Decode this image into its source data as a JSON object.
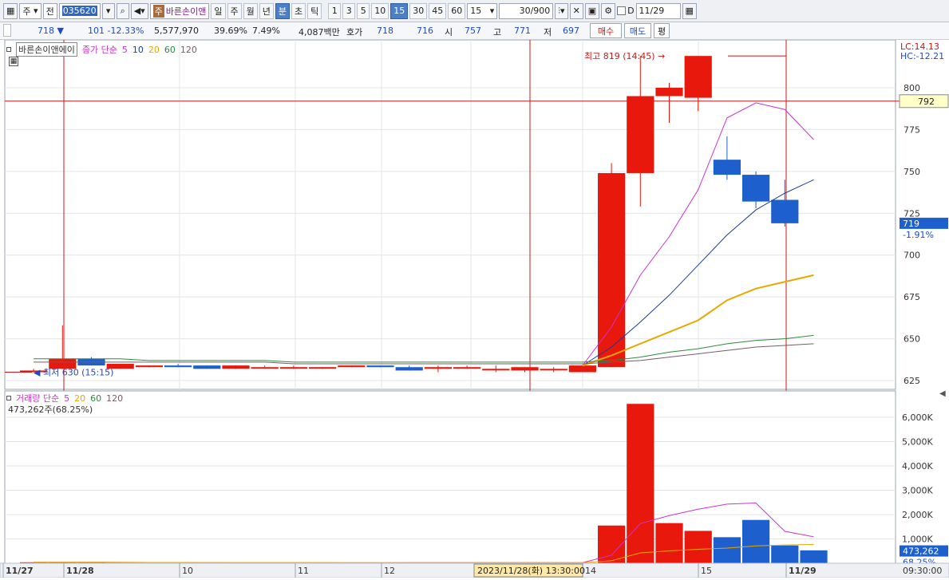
{
  "toolbar": {
    "market": "주",
    "prev_label": "전",
    "code": "035620",
    "name_prefix": "주",
    "name": "바른손이앤",
    "periods": [
      "일",
      "주",
      "월",
      "년",
      "분",
      "초",
      "틱"
    ],
    "active_period": "분",
    "minute_buttons": [
      "1",
      "3",
      "5",
      "10",
      "15",
      "30",
      "45",
      "60"
    ],
    "active_minute": "15",
    "minute_select": "15",
    "count_value": "30",
    "count_total": "/900",
    "checkbox_label": "D",
    "date_value": "11/29"
  },
  "info": {
    "price": "718",
    "arrow": "▼",
    "change": "101",
    "change_pct": "-12.33%",
    "volume": "5,577,970",
    "vol_ratio": "39.69%",
    "turnover": "7.49%",
    "amount": "4,087백만",
    "hoga_label": "호가",
    "ask": "718",
    "bid": "716",
    "open_label": "시",
    "open": "757",
    "high_label": "고",
    "high": "771",
    "low_label": "저",
    "low": "697",
    "buy_label": "매수",
    "sell_label": "매도",
    "eval_label": "평"
  },
  "price_panel": {
    "stock_label": "바른손이앤에이",
    "ma_label": "종가 단순",
    "ma_periods": [
      "5",
      "10",
      "20",
      "60",
      "120"
    ],
    "lc": "LC:14.13",
    "hc": "HC:-12.21",
    "crosshair_price": "792",
    "current_price": "719",
    "current_pct": "-1.91%",
    "high_annotation": "최고 819 (14:45)",
    "low_annotation": "최저 630 (15:15)",
    "y_ticks": [
      "800",
      "775",
      "750",
      "725",
      "700",
      "675",
      "650",
      "625"
    ]
  },
  "volume_panel": {
    "label": "거래량 단순",
    "ma_periods": [
      "5",
      "20",
      "60",
      "120"
    ],
    "summary": "473,262주(68.25%)",
    "current_vol": "473,262",
    "current_pct": "68.25%",
    "y_ticks": [
      "6,000K",
      "5,000K",
      "4,000K",
      "3,000K",
      "2,000K",
      "1,000K"
    ]
  },
  "x_axis": {
    "labels": [
      "11/27",
      "11/28",
      "10",
      "11",
      "12",
      "14",
      "15",
      "11/29"
    ],
    "crosshair_time": "2023/11/28(화) 13:30:00",
    "right_label": "09:30:00"
  },
  "colors": {
    "up": "#e8180c",
    "down": "#1d5fcc",
    "ma5": "#cc33cc",
    "ma10": "#1a3d99",
    "ma20": "#e8a800",
    "ma60": "#2e8b3a",
    "ma120": "#7a5a6a"
  },
  "chart_data": {
    "type": "candlestick",
    "interval": "15 minutes",
    "candles": [
      {
        "o": 630,
        "h": 632,
        "l": 630,
        "c": 631
      },
      {
        "o": 632,
        "h": 658,
        "l": 632,
        "c": 638
      },
      {
        "o": 638,
        "h": 639,
        "l": 634,
        "c": 634
      },
      {
        "o": 632,
        "h": 635,
        "l": 632,
        "c": 635
      },
      {
        "o": 633,
        "h": 634,
        "l": 633,
        "c": 634
      },
      {
        "o": 634,
        "h": 635,
        "l": 633,
        "c": 633
      },
      {
        "o": 634,
        "h": 634,
        "l": 632,
        "c": 632
      },
      {
        "o": 632,
        "h": 634,
        "l": 632,
        "c": 634
      },
      {
        "o": 633,
        "h": 634,
        "l": 633,
        "c": 633
      },
      {
        "o": 633,
        "h": 634,
        "l": 632,
        "c": 633
      },
      {
        "o": 633,
        "h": 633,
        "l": 632,
        "c": 633
      },
      {
        "o": 633,
        "h": 634,
        "l": 633,
        "c": 634
      },
      {
        "o": 634,
        "h": 634,
        "l": 633,
        "c": 633
      },
      {
        "o": 633,
        "h": 634,
        "l": 631,
        "c": 631
      },
      {
        "o": 632,
        "h": 634,
        "l": 630,
        "c": 633
      },
      {
        "o": 633,
        "h": 634,
        "l": 632,
        "c": 633
      },
      {
        "o": 632,
        "h": 634,
        "l": 630,
        "c": 632
      },
      {
        "o": 631,
        "h": 633,
        "l": 630,
        "c": 633
      },
      {
        "o": 632,
        "h": 633,
        "l": 630,
        "c": 632
      },
      {
        "o": 630,
        "h": 634,
        "l": 630,
        "c": 634
      },
      {
        "o": 633,
        "h": 755,
        "l": 633,
        "c": 749
      },
      {
        "o": 749,
        "h": 819,
        "l": 729,
        "c": 795
      },
      {
        "o": 795,
        "h": 803,
        "l": 779,
        "c": 800
      },
      {
        "o": 794,
        "h": 819,
        "l": 786,
        "c": 819
      },
      {
        "o": 757,
        "h": 771,
        "l": 745,
        "c": 748
      },
      {
        "o": 748,
        "h": 750,
        "l": 728,
        "c": 732
      },
      {
        "o": 733,
        "h": 745,
        "l": 717,
        "c": 719
      }
    ],
    "volume": [
      40,
      45,
      40,
      20,
      20,
      20,
      25,
      25,
      20,
      20,
      20,
      20,
      25,
      30,
      20,
      20,
      25,
      30,
      25,
      20,
      1550,
      6550,
      1650,
      1330,
      1070,
      1780,
      730,
      530
    ],
    "ma": {
      "5": [
        null,
        null,
        null,
        null,
        null,
        null,
        null,
        null,
        null,
        null,
        null,
        null,
        null,
        null,
        null,
        null,
        null,
        null,
        null,
        634,
        657,
        688,
        711,
        739,
        782,
        791,
        787,
        769
      ],
      "10": [
        null,
        null,
        null,
        null,
        null,
        null,
        null,
        null,
        null,
        null,
        null,
        null,
        null,
        null,
        null,
        null,
        null,
        null,
        null,
        634,
        645,
        660,
        676,
        694,
        712,
        727,
        737,
        745
      ],
      "20": [
        null,
        null,
        null,
        null,
        null,
        null,
        null,
        null,
        null,
        null,
        null,
        null,
        null,
        null,
        null,
        null,
        null,
        null,
        null,
        634,
        640,
        647,
        654,
        661,
        673,
        680,
        684,
        688
      ],
      "60": [
        638,
        638,
        638,
        638,
        637,
        637,
        637,
        637,
        637,
        636,
        636,
        636,
        636,
        636,
        636,
        636,
        636,
        636,
        636,
        636,
        637,
        639,
        642,
        644,
        647,
        649,
        650,
        652
      ],
      "120": [
        636,
        636,
        636,
        636,
        636,
        636,
        636,
        636,
        636,
        635,
        635,
        635,
        635,
        635,
        635,
        635,
        635,
        635,
        635,
        635,
        636,
        637,
        639,
        641,
        643,
        645,
        646,
        647
      ]
    },
    "ylim_price": [
      620,
      830
    ],
    "ylim_volume": [
      0,
      6800
    ]
  }
}
